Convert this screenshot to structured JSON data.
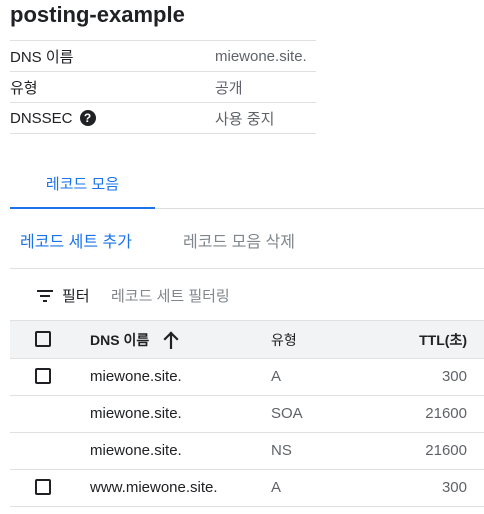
{
  "zone": {
    "title": "posting-example",
    "details": [
      {
        "key": "DNS 이름",
        "value": "miewone.site."
      },
      {
        "key": "유형",
        "value": "공개"
      },
      {
        "key": "DNSSEC",
        "value": "사용 중지",
        "help_icon": "help-circle-icon"
      }
    ]
  },
  "tabs": [
    {
      "label": "레코드 모음",
      "active": true
    }
  ],
  "actions": {
    "add_label": "레코드 세트 추가",
    "delete_label": "레코드 모음 삭제"
  },
  "filter": {
    "label": "필터",
    "placeholder": "레코드 세트 필터링",
    "icon": "filter-list-icon"
  },
  "table": {
    "headers": {
      "name": "DNS 이름",
      "type": "유형",
      "ttl": "TTL(초)"
    },
    "sort": {
      "column": "name",
      "direction": "ascending",
      "icon": "arrow-up-icon"
    },
    "rows": [
      {
        "name": "miewone.site.",
        "type": "A",
        "ttl": "300",
        "selectable": true
      },
      {
        "name": "miewone.site.",
        "type": "SOA",
        "ttl": "21600",
        "selectable": false
      },
      {
        "name": "miewone.site.",
        "type": "NS",
        "ttl": "21600",
        "selectable": false
      },
      {
        "name": "www.miewone.site.",
        "type": "A",
        "ttl": "300",
        "selectable": true
      }
    ]
  },
  "colors": {
    "accent": "#1a73e8",
    "text": "#202124",
    "muted": "#5f6368",
    "header_bg": "#f1f3f4",
    "divider": "#e0e0e0"
  }
}
